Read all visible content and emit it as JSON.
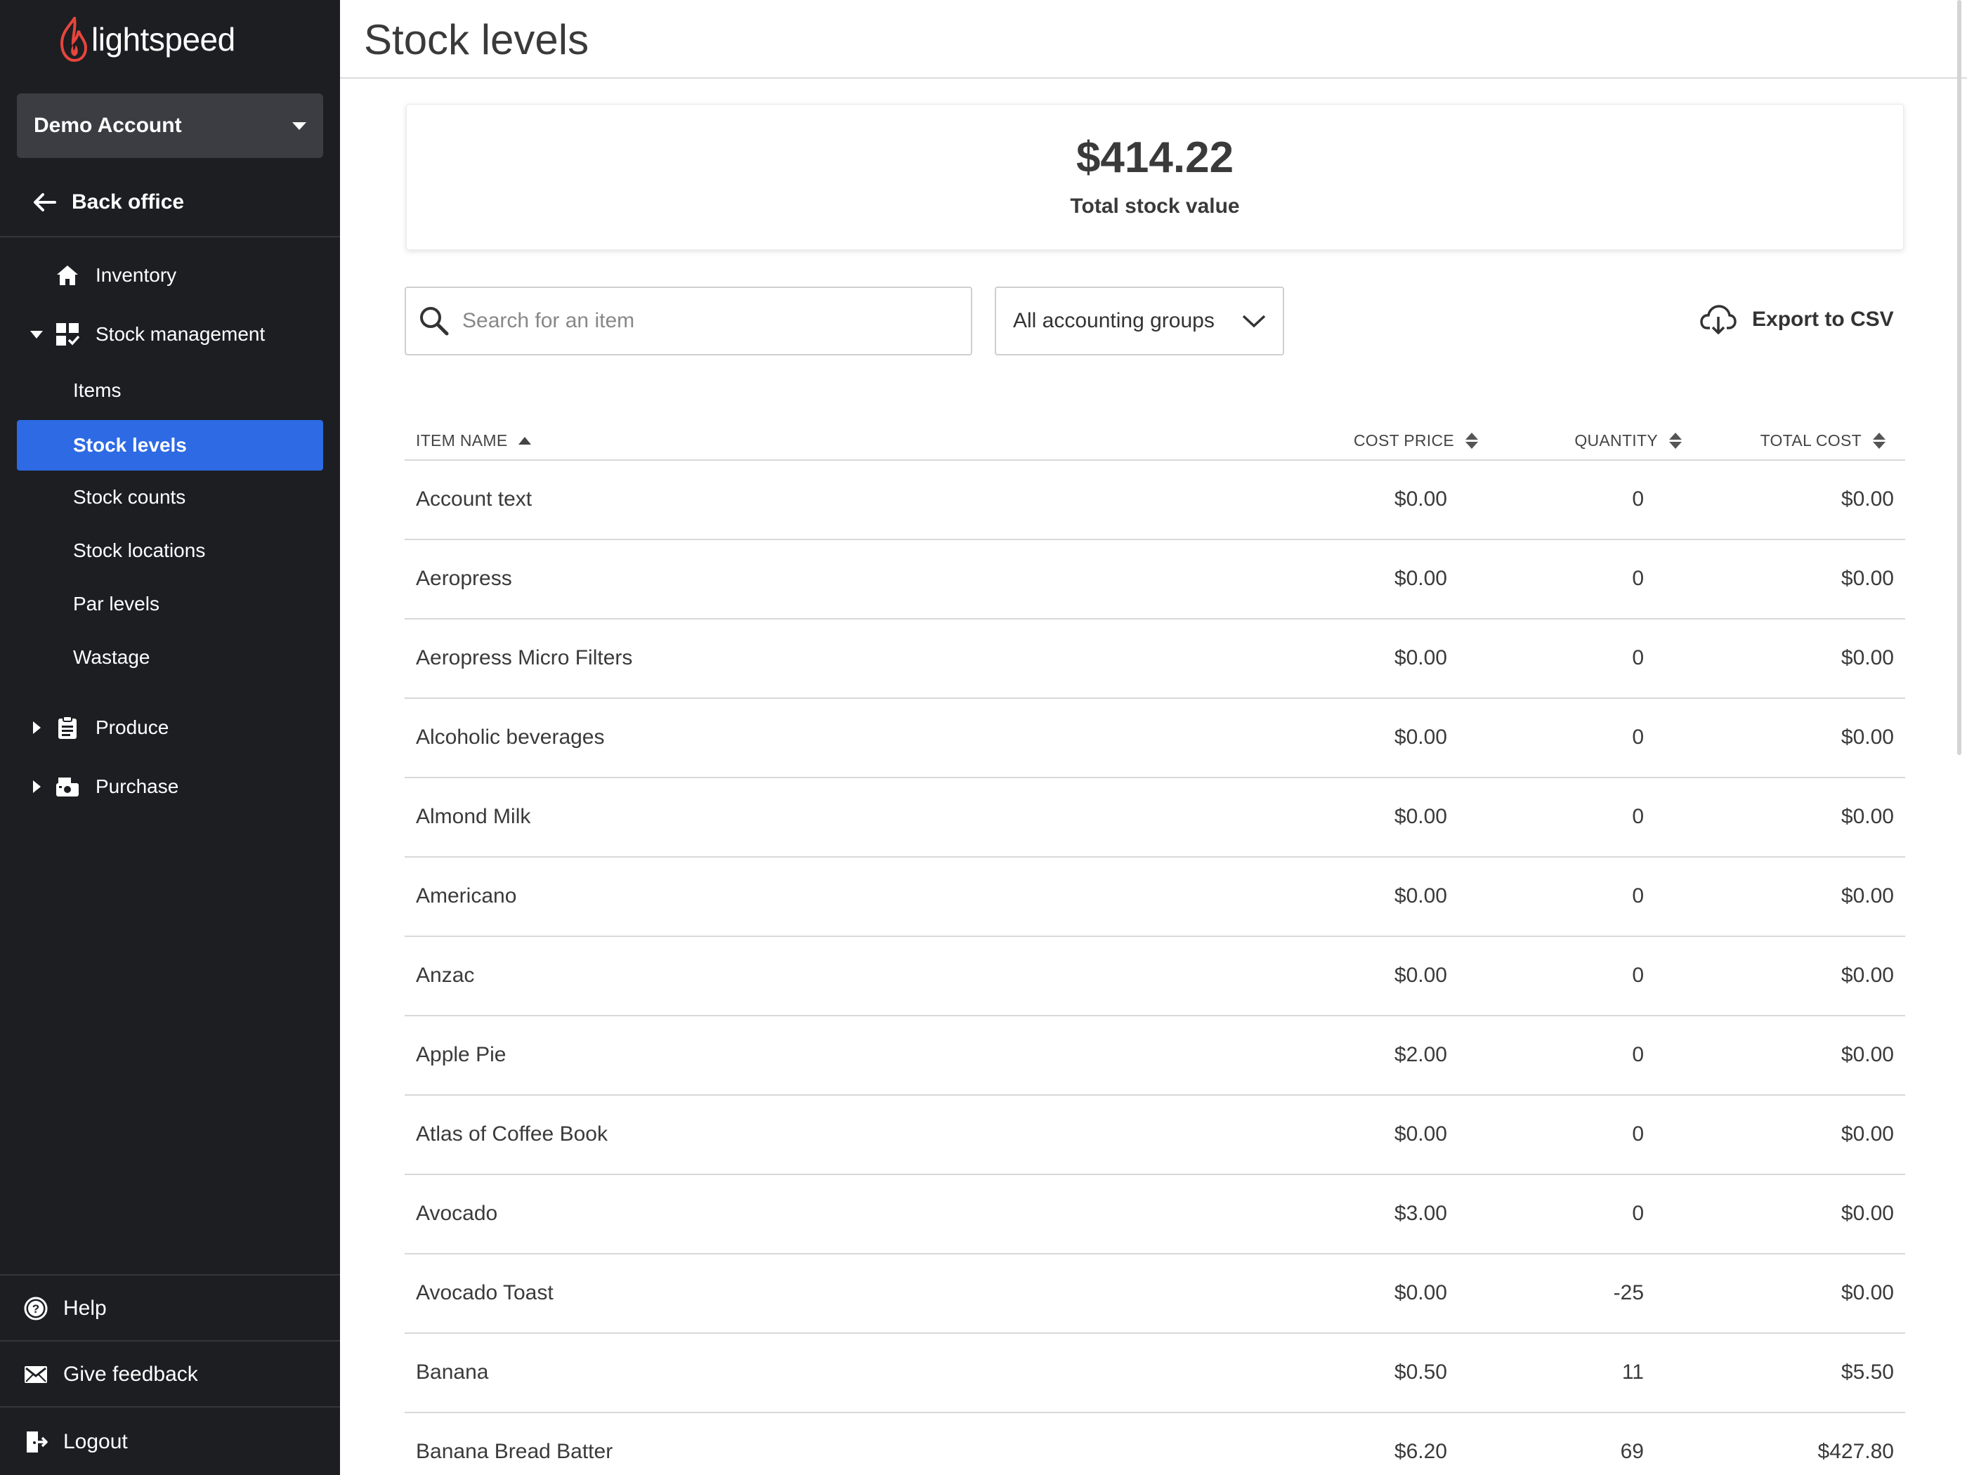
{
  "app": {
    "logo_text": "lightspeed"
  },
  "account": {
    "name": "Demo Account"
  },
  "nav": {
    "back_label": "Back office",
    "inventory": "Inventory",
    "stock_management": "Stock management",
    "sub_items": [
      "Items",
      "Stock levels",
      "Stock counts",
      "Stock locations",
      "Par levels",
      "Wastage"
    ],
    "active_sub_item": "Stock levels",
    "produce": "Produce",
    "purchase": "Purchase"
  },
  "footer": {
    "help": "Help",
    "feedback": "Give feedback",
    "logout": "Logout"
  },
  "page": {
    "title": "Stock levels"
  },
  "summary": {
    "value": "$414.22",
    "label": "Total stock value"
  },
  "filters": {
    "search_placeholder": "Search for an item",
    "group_select": "All accounting groups",
    "export_label": "Export to CSV"
  },
  "table": {
    "headers": {
      "name": "ITEM NAME",
      "cost": "COST PRICE",
      "qty": "QUANTITY",
      "total": "TOTAL COST"
    },
    "sort": {
      "column": "ITEM NAME",
      "direction": "ascending"
    },
    "rows": [
      {
        "name": "Account text",
        "cost": "$0.00",
        "qty": "0",
        "total": "$0.00"
      },
      {
        "name": "Aeropress",
        "cost": "$0.00",
        "qty": "0",
        "total": "$0.00"
      },
      {
        "name": "Aeropress Micro Filters",
        "cost": "$0.00",
        "qty": "0",
        "total": "$0.00"
      },
      {
        "name": "Alcoholic beverages",
        "cost": "$0.00",
        "qty": "0",
        "total": "$0.00"
      },
      {
        "name": "Almond Milk",
        "cost": "$0.00",
        "qty": "0",
        "total": "$0.00"
      },
      {
        "name": "Americano",
        "cost": "$0.00",
        "qty": "0",
        "total": "$0.00"
      },
      {
        "name": "Anzac",
        "cost": "$0.00",
        "qty": "0",
        "total": "$0.00"
      },
      {
        "name": "Apple Pie",
        "cost": "$2.00",
        "qty": "0",
        "total": "$0.00"
      },
      {
        "name": "Atlas of Coffee Book",
        "cost": "$0.00",
        "qty": "0",
        "total": "$0.00"
      },
      {
        "name": "Avocado",
        "cost": "$3.00",
        "qty": "0",
        "total": "$0.00"
      },
      {
        "name": "Avocado Toast",
        "cost": "$0.00",
        "qty": "-25",
        "total": "$0.00"
      },
      {
        "name": "Banana",
        "cost": "$0.50",
        "qty": "11",
        "total": "$5.50"
      },
      {
        "name": "Banana Bread Batter",
        "cost": "$6.20",
        "qty": "69",
        "total": "$427.80"
      }
    ]
  },
  "colors": {
    "sidebar_bg": "#1c1e22",
    "active_blue": "#2d6ae3",
    "brand_red": "#e8453c"
  }
}
